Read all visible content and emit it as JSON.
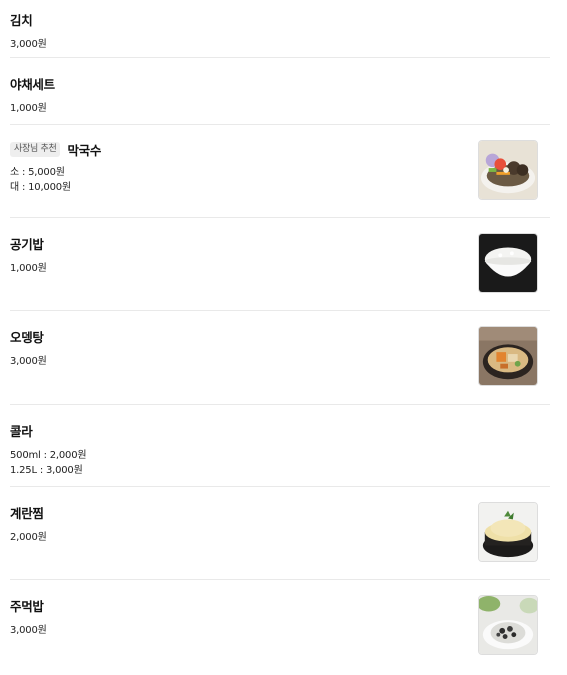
{
  "menu": {
    "items": [
      {
        "name": "김치",
        "prices": [
          "3,000원"
        ]
      },
      {
        "name": "야채세트",
        "prices": [
          "1,000원"
        ]
      },
      {
        "name": "막국수",
        "badge": "사장님 추천",
        "prices": [
          "소 : 5,000원",
          "대 : 10,000원"
        ],
        "image": "buckwheat-noodle-photo"
      },
      {
        "name": "공기밥",
        "prices": [
          "1,000원"
        ],
        "image": "rice-bowl-photo"
      },
      {
        "name": "오뎅탕",
        "prices": [
          "3,000원"
        ],
        "image": "fishcake-soup-photo"
      },
      {
        "name": "콜라",
        "prices": [
          "500ml : 2,000원",
          "1.25L : 3,000원"
        ]
      },
      {
        "name": "계란찜",
        "prices": [
          "2,000원"
        ],
        "image": "steamed-egg-photo"
      },
      {
        "name": "주먹밥",
        "prices": [
          "3,000원"
        ],
        "image": "rice-ball-photo"
      }
    ]
  }
}
